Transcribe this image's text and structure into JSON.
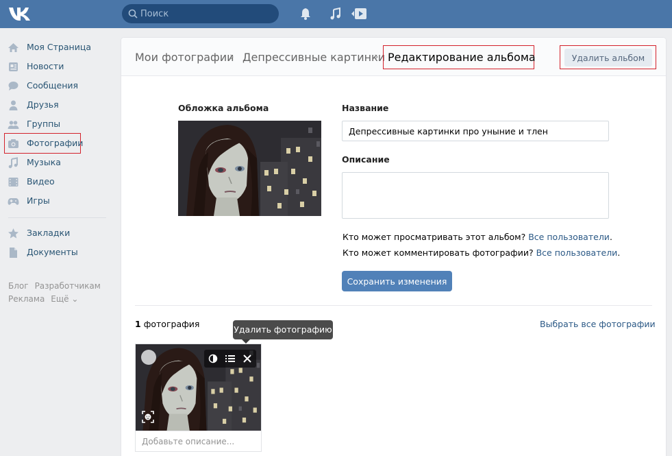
{
  "topbar": {
    "search_placeholder": "Поиск",
    "brand_color": "#4a76a8"
  },
  "sidebar": {
    "items": [
      {
        "label": "Моя Страница",
        "icon": "home-icon"
      },
      {
        "label": "Новости",
        "icon": "news-icon"
      },
      {
        "label": "Сообщения",
        "icon": "messages-icon"
      },
      {
        "label": "Друзья",
        "icon": "friend-icon"
      },
      {
        "label": "Группы",
        "icon": "groups-icon"
      },
      {
        "label": "Фотографии",
        "icon": "camera-icon",
        "active": true
      },
      {
        "label": "Музыка",
        "icon": "music-note-icon"
      },
      {
        "label": "Видео",
        "icon": "film-icon"
      },
      {
        "label": "Игры",
        "icon": "gamepad-icon"
      },
      {
        "label": "Закладки",
        "icon": "star-icon"
      },
      {
        "label": "Документы",
        "icon": "document-icon"
      }
    ],
    "footer": {
      "blog": "Блог",
      "developers": "Разработчикам",
      "ads": "Реклама",
      "more": "Ещё ⌄"
    }
  },
  "header": {
    "crumb_1": "Мои фотографии",
    "crumb_2": "Депрессивные картинки",
    "current": "Редактирование альбома",
    "delete_album": "Удалить альбом"
  },
  "form": {
    "cover_label": "Обложка альбома",
    "name_label": "Название",
    "name_value": "Депрессивные картинки про уныние и тлен",
    "description_label": "Описание",
    "description_value": "",
    "view_question": "Кто может просматривать этот альбом?",
    "view_value": "Все пользователи",
    "comment_question": "Кто может комментировать фотографии?",
    "comment_value": "Все пользователи",
    "save": "Сохранить изменения"
  },
  "photos": {
    "count_number": "1",
    "count_word": "фотография",
    "select_all": "Выбрать все фотографии",
    "tooltip": "Удалить фотографию",
    "description_placeholder": "Добавьте описание..."
  }
}
